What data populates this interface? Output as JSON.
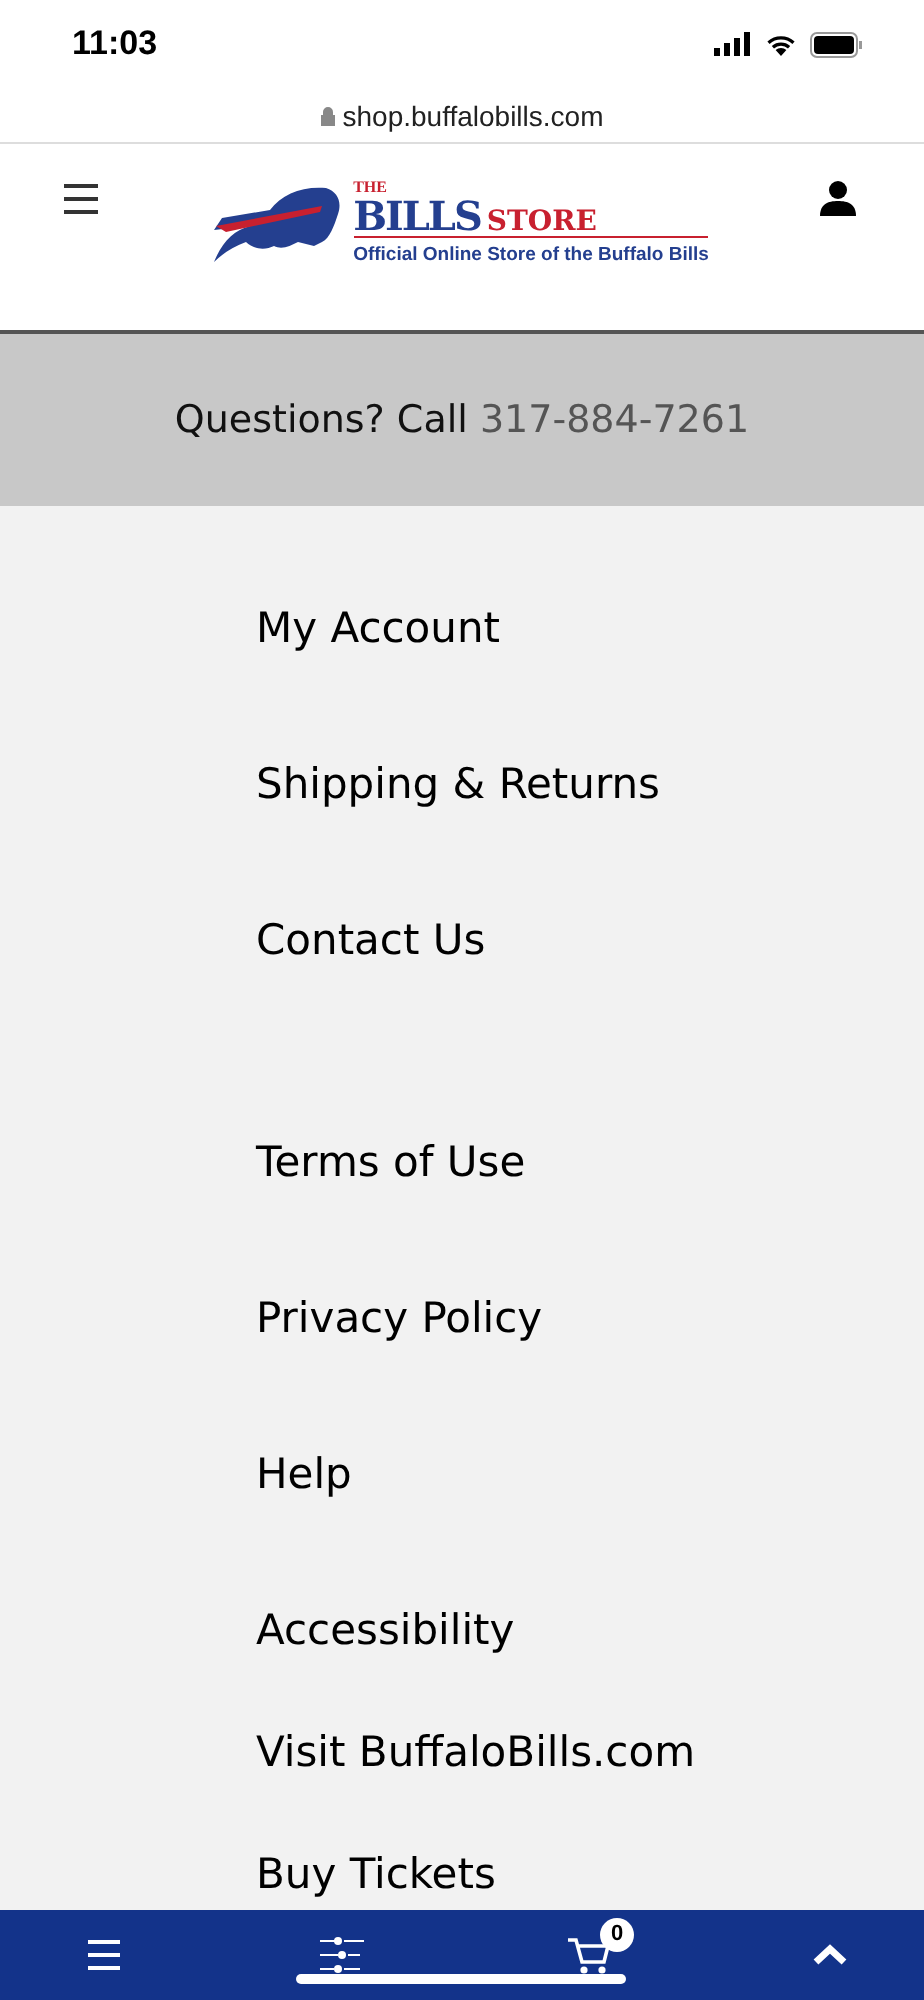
{
  "status_bar": {
    "time": "11:03"
  },
  "browser": {
    "url": "shop.buffalobills.com"
  },
  "header": {
    "logo": {
      "the": "THE",
      "bills": "BILLS",
      "store": "STORE",
      "tagline": "Official Online Store of the Buffalo Bills"
    }
  },
  "banner": {
    "text": "Questions? Call",
    "phone": "317-884-7261"
  },
  "menu": {
    "groups": [
      {
        "items": [
          "My Account",
          "Shipping & Returns",
          "Contact Us"
        ]
      },
      {
        "items": [
          "Terms of Use",
          "Privacy Policy",
          "Help",
          "Accessibility",
          "Visit BuffaloBills.com",
          "Buy Tickets"
        ]
      }
    ]
  },
  "bottom_bar": {
    "cart_count": "0"
  }
}
